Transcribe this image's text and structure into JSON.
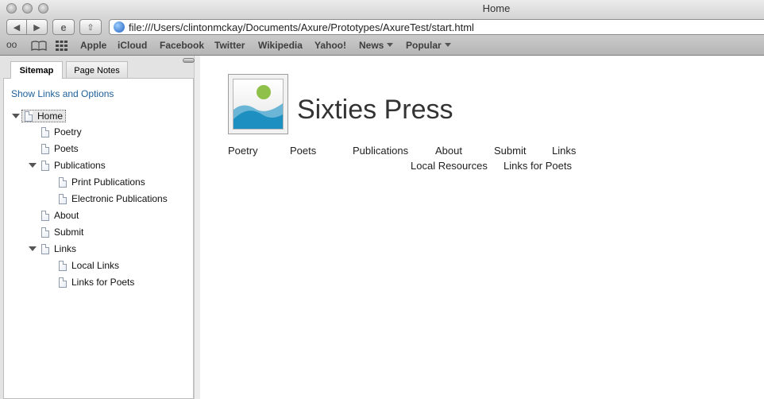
{
  "window": {
    "title": "Home"
  },
  "browser": {
    "url": "file:///Users/clintonmckay/Documents/Axure/Prototypes/AxureTest/start.html",
    "bookmarks": [
      "Apple",
      "iCloud",
      "Facebook",
      "Twitter",
      "Wikipedia",
      "Yahoo!"
    ],
    "bookmark_menus": [
      "News",
      "Popular"
    ]
  },
  "sidebar": {
    "tabs": [
      "Sitemap",
      "Page Notes"
    ],
    "active_tab": "Sitemap",
    "show_links": "Show Links and Options",
    "tree": [
      {
        "label": "Home",
        "level": 0,
        "expanded": true,
        "selected": true
      },
      {
        "label": "Poetry",
        "level": 1
      },
      {
        "label": "Poets",
        "level": 1
      },
      {
        "label": "Publications",
        "level": 1,
        "expanded": true
      },
      {
        "label": "Print Publications",
        "level": 2
      },
      {
        "label": "Electronic Publications",
        "level": 2
      },
      {
        "label": "About",
        "level": 1
      },
      {
        "label": "Submit",
        "level": 1
      },
      {
        "label": "Links",
        "level": 1,
        "expanded": true
      },
      {
        "label": "Local Links",
        "level": 2
      },
      {
        "label": "Links for Poets",
        "level": 2
      }
    ]
  },
  "page": {
    "title": "Sixties Press",
    "nav": [
      "Poetry",
      "Poets",
      "Publications",
      "About",
      "Submit",
      "Links"
    ],
    "subnav": [
      "Local Resources",
      "Links for Poets"
    ]
  }
}
